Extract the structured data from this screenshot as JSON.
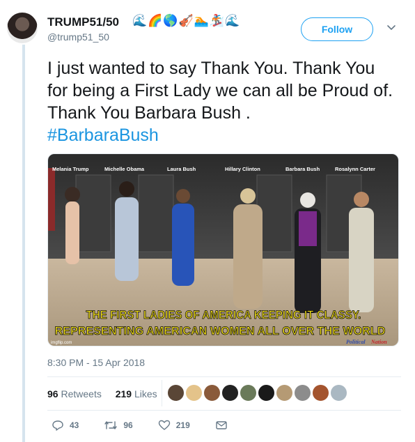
{
  "tweet": {
    "display_name": "TRUMP51/50",
    "emoji": "🌊🌈🌎🎻🏊🏂🌊",
    "handle": "@trump51_50",
    "follow_label": "Follow",
    "text_line": "I just wanted to say Thank You. Thank You for being a First Lady we can all be Proud of. Thank You Barbara Bush .",
    "hashtag": "#BarbaraBush",
    "timestamp": "8:30 PM - 15 Apr 2018"
  },
  "media": {
    "names": [
      "Melania Trump",
      "Michelle Obama",
      "Laura Bush",
      "Hillary Clinton",
      "Barbara Bush",
      "Rosalynn Carter"
    ],
    "caption_line1": "THE FIRST LADIES OF AMERICA KEEPING IT CLASSY.",
    "caption_line2": "REPRESENTING  AMERICAN WOMEN ALL OVER THE WORLD",
    "watermark": "imgflip.com",
    "signature_line1": "Political",
    "signature_line2": "Nation",
    "caption_color": "#f5e21a"
  },
  "stats": {
    "retweets_count": "96",
    "retweets_label": "Retweets",
    "likes_count": "219",
    "likes_label": "Likes"
  },
  "actions": {
    "replies": "43",
    "retweets": "96",
    "likes": "219"
  },
  "colors": {
    "accent": "#1da1f2",
    "link": "#1b95e0",
    "muted": "#657786"
  }
}
